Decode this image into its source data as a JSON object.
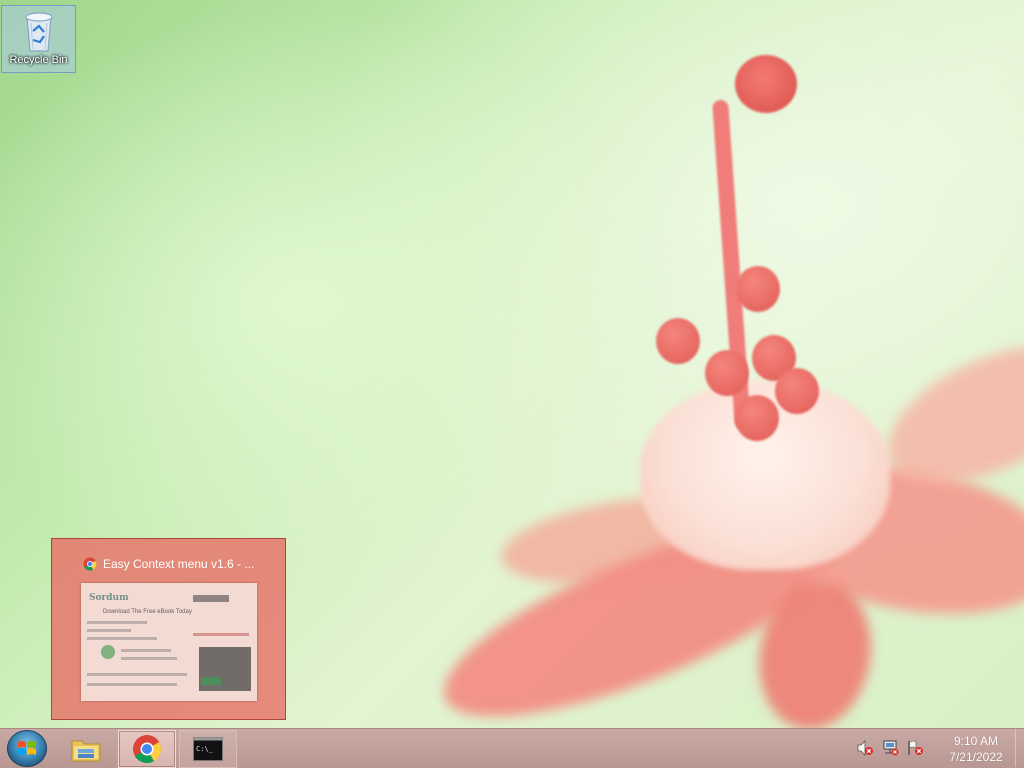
{
  "desktop": {
    "icons": [
      {
        "label": "Recycle Bin",
        "icon": "recycle-bin-icon"
      }
    ]
  },
  "thumbnail_preview": {
    "title": "Easy Context menu v1.6 - ...",
    "icon": "chrome-icon",
    "page_headline": "Download The Free eBook Today",
    "site_logo": "Sordum"
  },
  "taskbar": {
    "start_icon": "windows-logo-icon",
    "pinned": [
      {
        "name": "File Explorer",
        "icon": "folder-icon"
      },
      {
        "name": "Google Chrome",
        "icon": "chrome-icon",
        "active": true
      },
      {
        "name": "Command Prompt",
        "icon": "cmd-icon",
        "text": "C:\\_"
      }
    ],
    "tray": {
      "icons": [
        "volume-muted-icon",
        "network-disconnected-icon",
        "action-center-flag-icon"
      ],
      "time": "9:10 AM",
      "date": "7/21/2022"
    }
  },
  "colors": {
    "taskbar": "#c4a39e",
    "thumbnail_bg": "#e86c64",
    "wallpaper_green": "#b8e4a0",
    "flower_pink": "#f38f85"
  }
}
